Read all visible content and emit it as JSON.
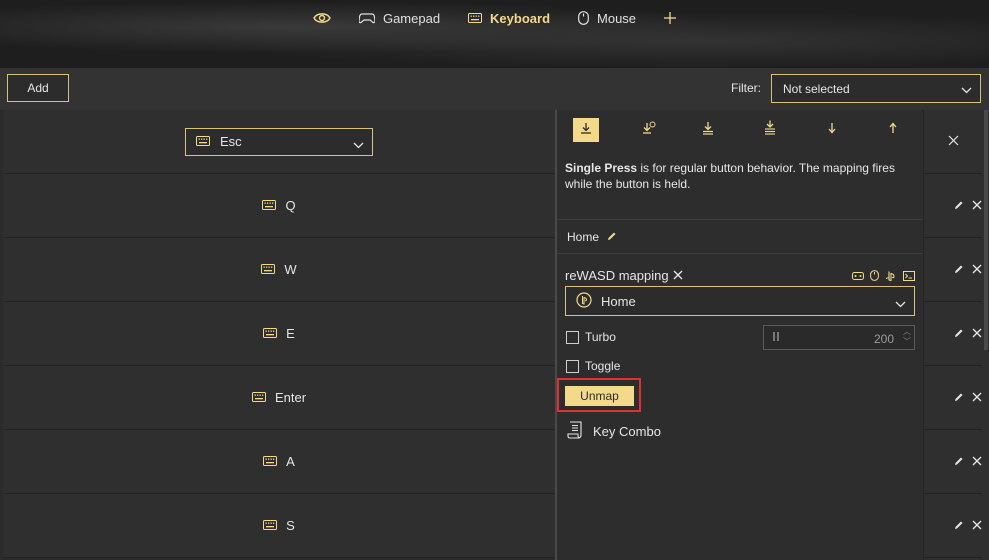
{
  "nav": {
    "items": [
      {
        "label": "",
        "icon": "eye-icon"
      },
      {
        "label": "Gamepad",
        "icon": "gamepad-icon"
      },
      {
        "label": "Keyboard",
        "icon": "keyboard-icon",
        "active": true
      },
      {
        "label": "Mouse",
        "icon": "mouse-icon"
      },
      {
        "label": "",
        "icon": "plus-icon"
      }
    ]
  },
  "toolbar": {
    "add_label": "Add",
    "filter_label": "Filter:",
    "filter_value": "Not selected"
  },
  "rows": [
    {
      "label": "Esc",
      "type": "select"
    },
    {
      "label": "Q"
    },
    {
      "label": "W"
    },
    {
      "label": "E"
    },
    {
      "label": "Enter"
    },
    {
      "label": "A"
    },
    {
      "label": "S"
    }
  ],
  "panel": {
    "tabs": [
      "single-press-icon",
      "long-press-icon",
      "double-press-icon",
      "triple-press-icon",
      "down-icon",
      "up-icon"
    ],
    "desc_bold": "Single Press",
    "desc_rest": " is for regular button behavior. The mapping fires while the button is held.",
    "mapping_name": "Home",
    "mapping_header": "reWASD mapping",
    "mapping_value": "Home",
    "turbo_label": "Turbo",
    "turbo_value": "200",
    "toggle_label": "Toggle",
    "unmap_label": "Unmap",
    "keycombo_label": "Key Combo"
  },
  "colors": {
    "accent": "#f3d98a",
    "accent_border": "#d9c37a",
    "highlight": "#e03030",
    "background": "#2b2b2b"
  }
}
